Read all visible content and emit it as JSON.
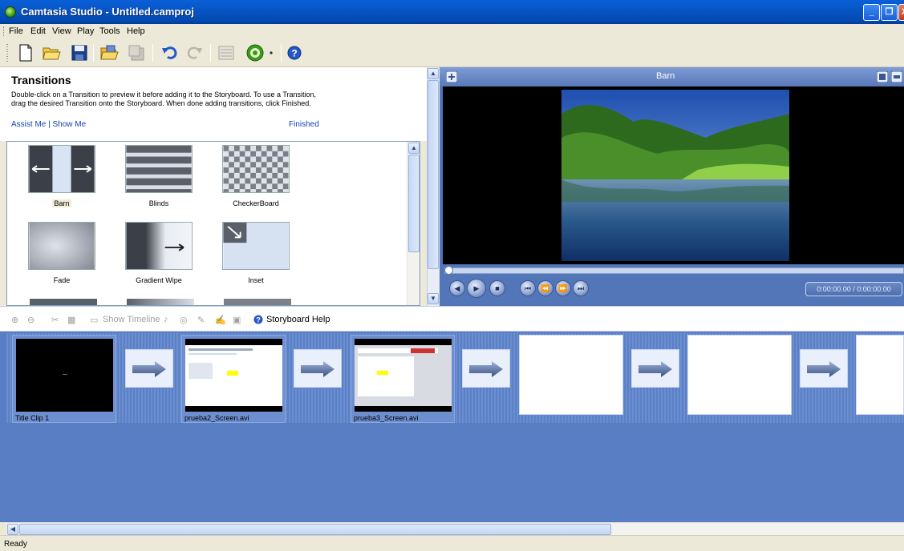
{
  "window": {
    "title": "Camtasia Studio - Untitled.camproj",
    "minimize_glyph": "_",
    "maximize_glyph": "❐",
    "close_glyph": "X"
  },
  "menu": {
    "items": [
      "File",
      "Edit",
      "View",
      "Play",
      "Tools",
      "Help"
    ]
  },
  "toolbar": {
    "icons": [
      "new-icon",
      "open-icon",
      "save-icon",
      "import-icon",
      "save-disabled-icon",
      "undo-icon",
      "redo-icon",
      "timeline-icon",
      "produce-icon",
      "help-icon"
    ]
  },
  "transitions": {
    "title": "Transitions",
    "description": "Double-click on a Transition to preview it before adding it to the Storyboard. To use a Transition, drag the desired Transition onto the Storyboard.  When done adding transitions, click Finished.",
    "assist_link": "Assist Me | Show Me",
    "finished_link": "Finished",
    "items": [
      {
        "label": "Barn"
      },
      {
        "label": "Blinds"
      },
      {
        "label": "CheckerBoard"
      },
      {
        "label": "Fade"
      },
      {
        "label": "Gradient Wipe"
      },
      {
        "label": "Inset"
      }
    ],
    "selected": "Barn"
  },
  "preview": {
    "title": "Barn",
    "time": "0:00:00.00 / 0:00:00.00"
  },
  "storyboard": {
    "show_timeline_label": "Show Timeline",
    "help_label": "Storyboard Help",
    "clips": [
      {
        "name": "Title Clip 1"
      },
      {
        "name": "prueba2_Screen.avi"
      },
      {
        "name": "prueba3_Screen.avi"
      }
    ]
  },
  "status": {
    "text": "Ready"
  },
  "colors": {
    "titlebar": "#0a5fd8",
    "storyboard_bg": "#5a7ec4",
    "link": "#1545b0"
  }
}
